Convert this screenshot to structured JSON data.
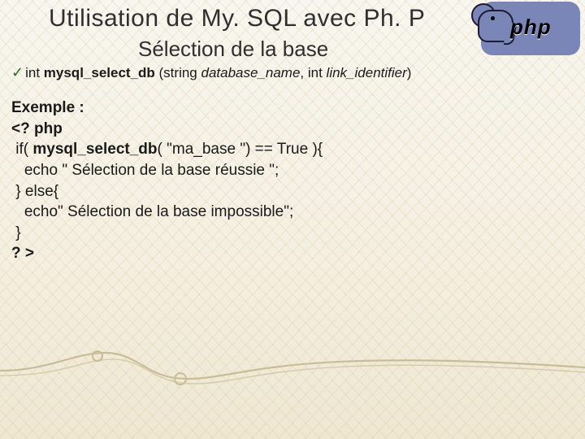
{
  "title": "Utilisation de My. SQL avec Ph. P",
  "subtitle": "Sélection de la base",
  "logo_text": "php",
  "signature": {
    "check": "✓",
    "ret": "int ",
    "fn": "mysql_select_db",
    "open": " (string ",
    "arg1": "database_name",
    "mid": ", int ",
    "arg2": "link_identifier",
    "close": ")"
  },
  "example": {
    "l1": "Exemple :",
    "l2": "<? php",
    "l3a": " if( ",
    "l3b": "mysql_select_db",
    "l3c": "( \"ma_base \") == True ){",
    "l4": "   echo \" Sélection de la base réussie \";",
    "l5": " } else{",
    "l6": "   echo\" Sélection de la base impossible\";",
    "l7": " }",
    "l8": "? >"
  }
}
